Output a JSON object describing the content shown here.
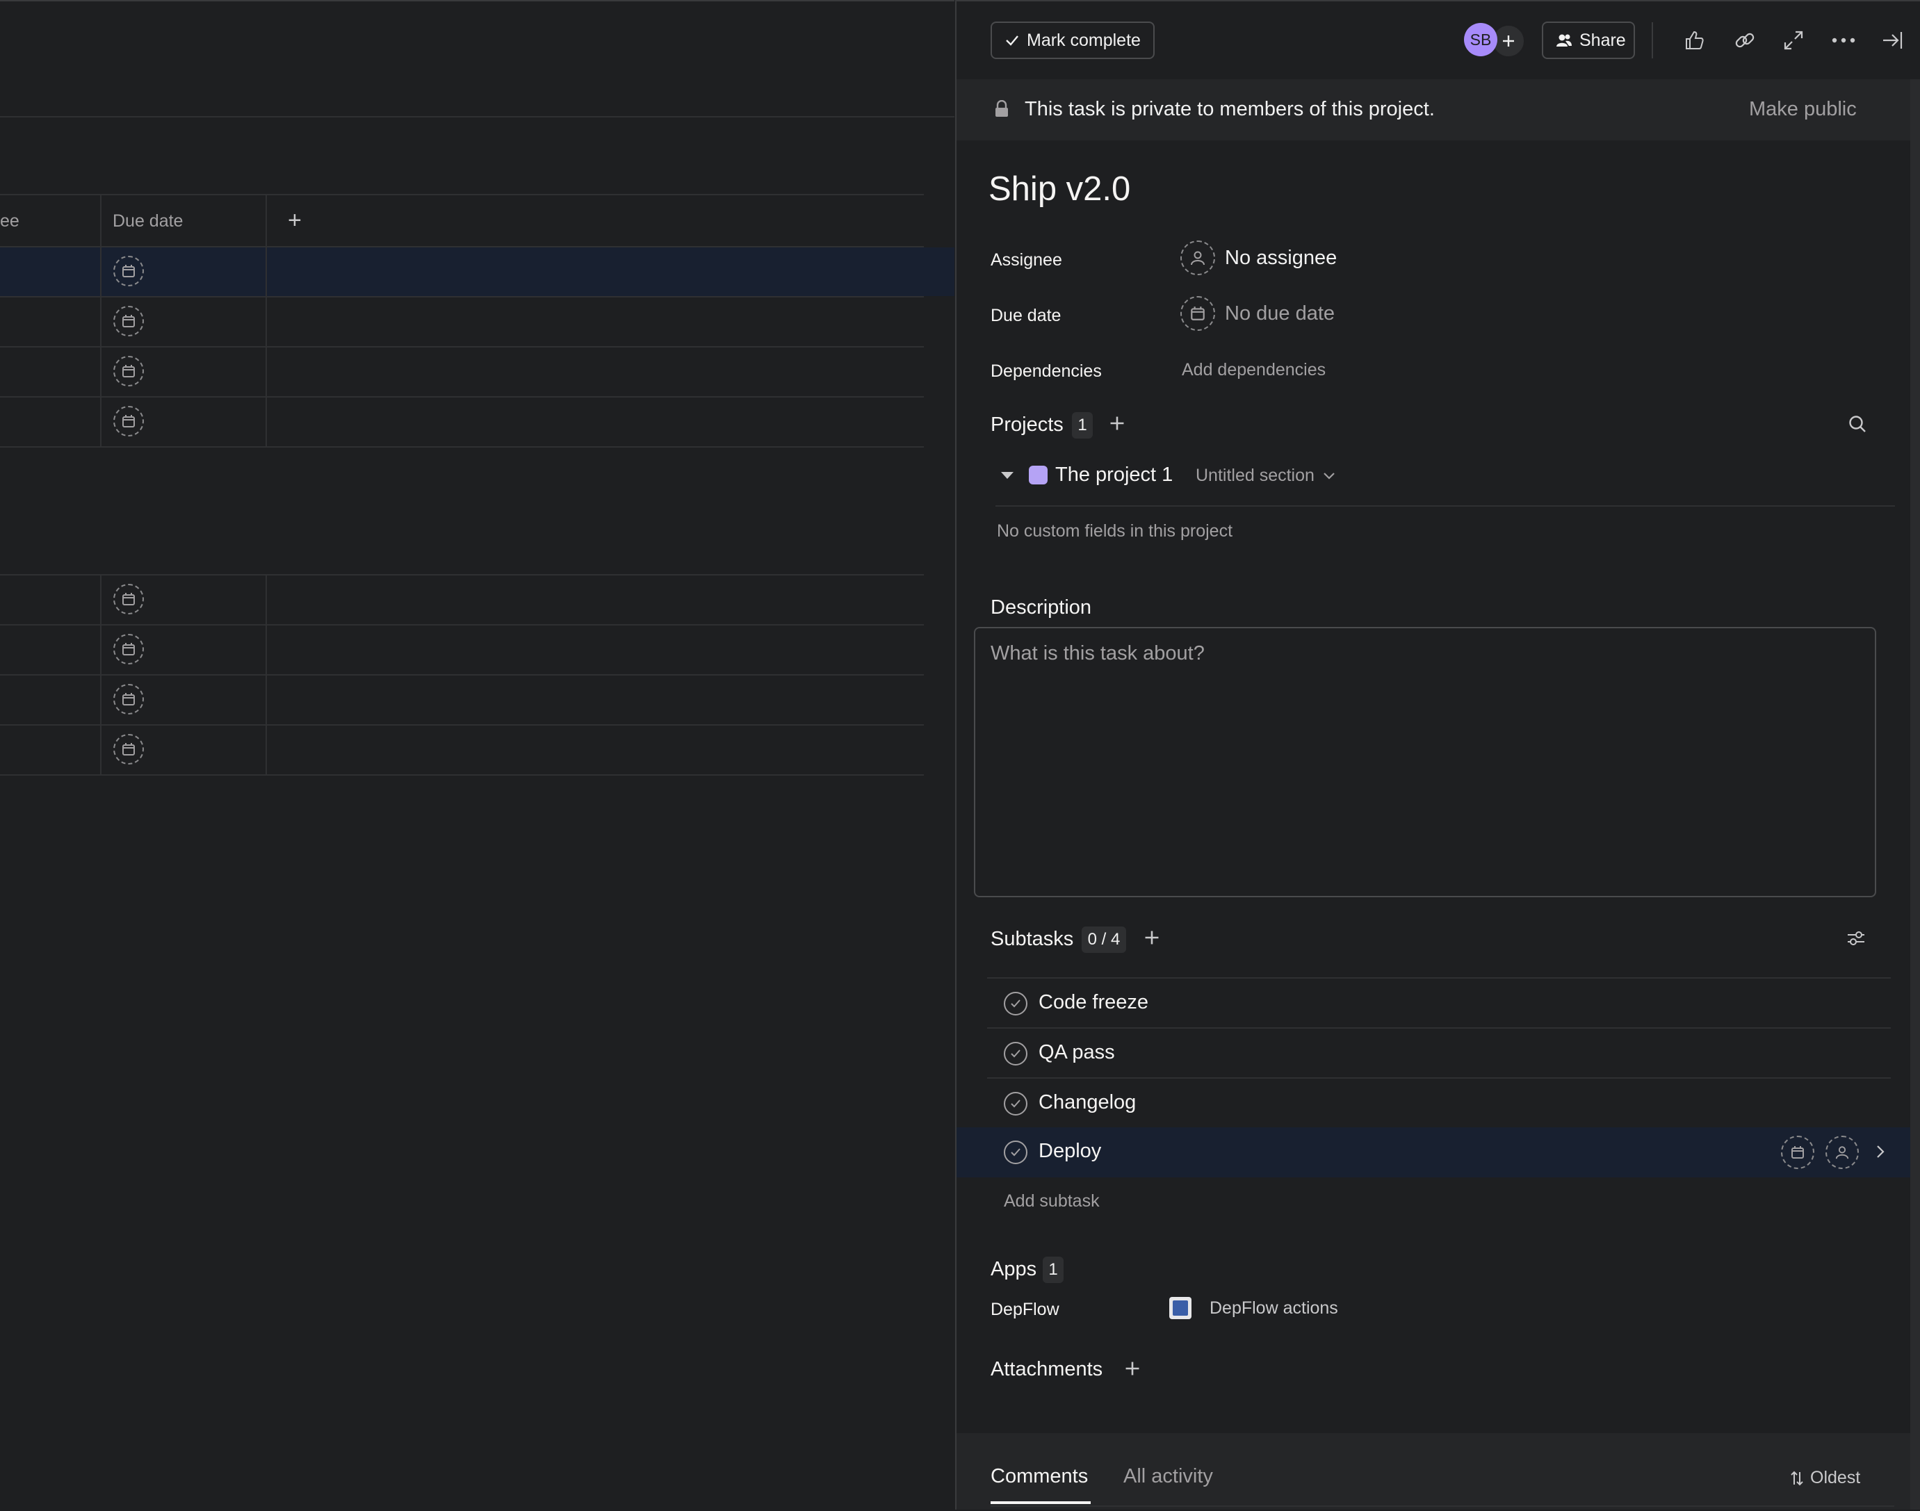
{
  "list": {
    "col_assignee_partial": "ee",
    "col_due_date": "Due date",
    "add_column_symbol": "+"
  },
  "pane": {
    "header": {
      "mark_complete": "Mark complete",
      "avatar_initials": "SB",
      "share": "Share"
    },
    "privacy": {
      "message": "This task is private to members of this project.",
      "make_public": "Make public"
    },
    "title": "Ship v2.0",
    "fields": {
      "assignee_label": "Assignee",
      "assignee_value": "No assignee",
      "due_date_label": "Due date",
      "due_date_value": "No due date",
      "dependencies_label": "Dependencies",
      "dependencies_value": "Add dependencies"
    },
    "projects": {
      "title": "Projects",
      "count": "1",
      "project_name": "The project 1",
      "project_color": "#b5a3f5",
      "section": "Untitled section",
      "no_fields": "No custom fields in this project"
    },
    "description": {
      "title": "Description",
      "placeholder": "What is this task about?"
    },
    "subtasks": {
      "title": "Subtasks",
      "count": "0 / 4",
      "items": [
        "Code freeze",
        "QA pass",
        "Changelog",
        "Deploy"
      ],
      "add": "Add subtask"
    },
    "apps": {
      "title": "Apps",
      "count": "1",
      "app_label": "DepFlow",
      "app_action": "DepFlow actions"
    },
    "attachments": {
      "title": "Attachments"
    },
    "tabs": {
      "comments": "Comments",
      "all_activity": "All activity",
      "sort": "Oldest"
    }
  },
  "colors": {
    "background": "#1e1f21",
    "avatar": "#a78bfa",
    "row_highlight": "#182030"
  }
}
